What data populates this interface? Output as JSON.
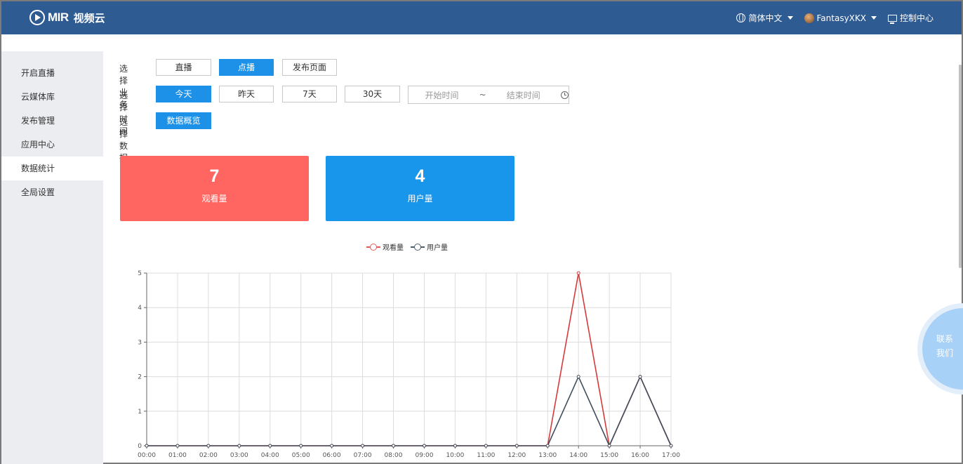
{
  "header": {
    "logo_text": "MIR",
    "logo_cn": "视频云",
    "language": "简体中文",
    "username": "FantasyXKX",
    "console": "控制中心"
  },
  "sidebar": {
    "items": [
      {
        "label": "开启直播"
      },
      {
        "label": "云媒体库"
      },
      {
        "label": "发布管理"
      },
      {
        "label": "应用中心"
      },
      {
        "label": "数据统计",
        "active": true
      },
      {
        "label": "全局设置"
      }
    ]
  },
  "filters": {
    "business_label": "选择业务",
    "business_options": [
      "直播",
      "点播",
      "发布页面"
    ],
    "business_selected": "点播",
    "time_label": "选择时间",
    "time_options": [
      "今天",
      "昨天",
      "7天",
      "30天"
    ],
    "time_selected": "今天",
    "start_placeholder": "开始时间",
    "range_separator": "~",
    "end_placeholder": "结束时间",
    "data_label": "选择数据",
    "data_options": [
      "数据概览"
    ],
    "data_selected": "数据概览"
  },
  "stats": [
    {
      "value": "7",
      "label": "观看量",
      "color": "#ff6561"
    },
    {
      "value": "4",
      "label": "用户量",
      "color": "#1796ec"
    }
  ],
  "chart_data": {
    "type": "line",
    "legend": [
      "观看量",
      "用户量"
    ],
    "legend_position": "top-center",
    "categories": [
      "00:00",
      "01:00",
      "02:00",
      "03:00",
      "04:00",
      "05:00",
      "06:00",
      "07:00",
      "08:00",
      "09:00",
      "10:00",
      "11:00",
      "12:00",
      "13:00",
      "14:00",
      "15:00",
      "16:00",
      "17:00"
    ],
    "series": [
      {
        "name": "观看量",
        "color": "#d63a3a",
        "values": [
          0,
          0,
          0,
          0,
          0,
          0,
          0,
          0,
          0,
          0,
          0,
          0,
          0,
          0,
          5,
          0,
          2,
          0
        ]
      },
      {
        "name": "用户量",
        "color": "#3f4f5c",
        "values": [
          0,
          0,
          0,
          0,
          0,
          0,
          0,
          0,
          0,
          0,
          0,
          0,
          0,
          0,
          2,
          0,
          2,
          0
        ]
      }
    ],
    "ylim": [
      0,
      5
    ],
    "yticks": [
      0,
      1,
      2,
      3,
      4,
      5
    ],
    "grid": true
  },
  "contact": {
    "line1": "联系",
    "line2": "我们"
  }
}
